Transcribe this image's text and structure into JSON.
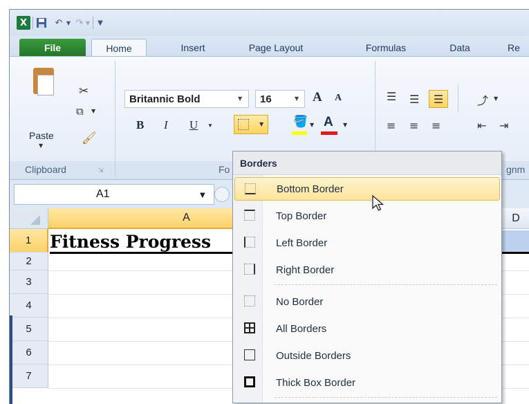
{
  "qat": {
    "logo": "X",
    "save_icon": "save-icon",
    "undo_icon": "undo-icon",
    "redo_icon": "redo-icon"
  },
  "tabs": {
    "file": "File",
    "home": "Home",
    "insert": "Insert",
    "page_layout": "Page Layout",
    "formulas": "Formulas",
    "data": "Data",
    "review": "Re"
  },
  "ribbon": {
    "clipboard_group": "Clipboard",
    "paste_label": "Paste",
    "font_group": "Fo",
    "alignment_group": "gnm",
    "font_name": "Britannic Bold",
    "font_size": "16",
    "bold": "B",
    "italic": "I",
    "underline": "U",
    "font_color_letter": "A",
    "grow_font": "A",
    "shrink_font": "A",
    "fill_color": "#ffff00",
    "font_color": "#e01b1b"
  },
  "formula_bar": {
    "name_box": "A1"
  },
  "grid": {
    "col_a": "A",
    "col_d": "D",
    "rows": [
      "1",
      "2",
      "3",
      "4",
      "5",
      "6",
      "7"
    ],
    "a1_value": "Fitness Progress"
  },
  "borders_menu": {
    "title": "Borders",
    "items": [
      {
        "label": "Bottom Border",
        "icon": "bottom-border-icon"
      },
      {
        "label": "Top Border",
        "icon": "top-border-icon"
      },
      {
        "label": "Left Border",
        "icon": "left-border-icon"
      },
      {
        "label": "Right Border",
        "icon": "right-border-icon"
      },
      {
        "label": "No Border",
        "icon": "no-border-icon"
      },
      {
        "label": "All Borders",
        "icon": "all-borders-icon"
      },
      {
        "label": "Outside Borders",
        "icon": "outside-borders-icon"
      },
      {
        "label": "Thick Box Border",
        "icon": "thick-box-border-icon"
      }
    ]
  }
}
